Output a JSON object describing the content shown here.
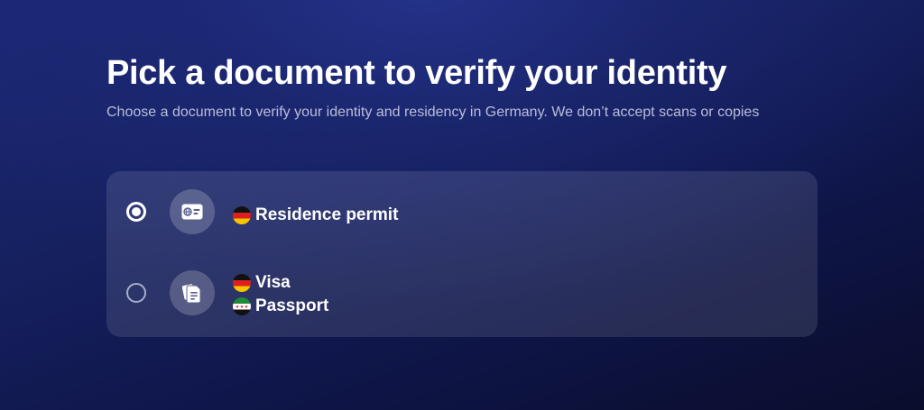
{
  "header": {
    "title": "Pick a document to verify your identity",
    "subtitle": "Choose a document to verify your identity and residency in Germany. We don’t accept scans or copies"
  },
  "options": [
    {
      "selected": true,
      "icon": "id-card-icon",
      "documents": [
        {
          "label": "Residence permit",
          "flag": "germany-flag-icon"
        }
      ]
    },
    {
      "selected": false,
      "icon": "documents-icon",
      "documents": [
        {
          "label": "Visa",
          "flag": "germany-flag-icon"
        },
        {
          "label": "Passport",
          "flag": "syria-flag-icon"
        }
      ]
    }
  ],
  "colors": {
    "background": "#141d5c",
    "card": "#2c3468",
    "text": "#ffffff",
    "subtitle": "#b9bedb"
  }
}
